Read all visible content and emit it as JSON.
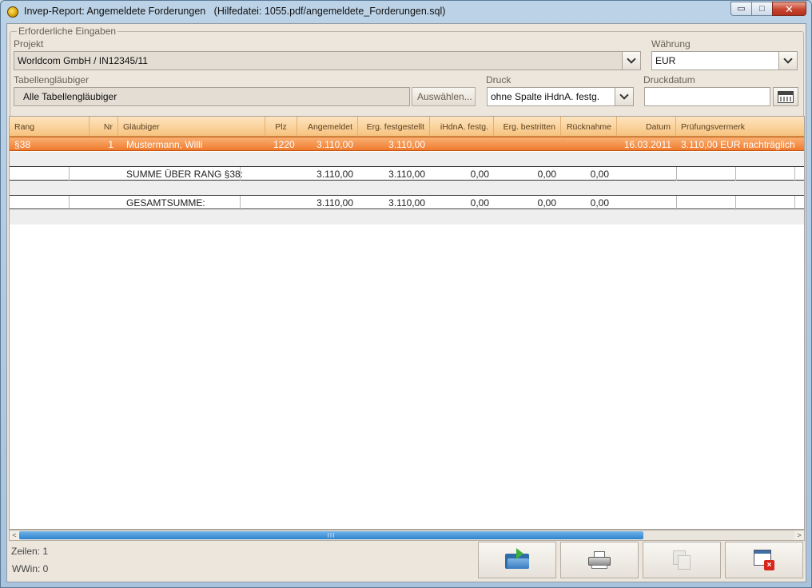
{
  "window": {
    "title": "Invep-Report: Angemeldete Forderungen",
    "helpfile": "(Hilfedatei: 1055.pdf/angemeldete_Forderungen.sql)",
    "minimize_glyph": "▭",
    "maximize_glyph": "□",
    "close_glyph": "✕"
  },
  "inputs": {
    "group_title": "Erforderliche Eingaben",
    "projekt_label": "Projekt",
    "projekt_value": "Worldcom GmbH / IN12345/11",
    "waehrung_label": "Währung",
    "waehrung_value": "EUR",
    "tabglaeubiger_label": "Tabellengläubiger",
    "tabglaeubiger_value": "Alle Tabellengläubiger",
    "auswaehlen_label": "Auswählen...",
    "druck_label": "Druck",
    "druck_value": "ohne Spalte iHdnA. festg.",
    "druckdatum_label": "Druckdatum",
    "druckdatum_value": ""
  },
  "table": {
    "columns": [
      "Rang",
      "Nr",
      "Gläubiger",
      "Plz",
      "Angemeldet",
      "Erg. festgestellt",
      "iHdnA. festg.",
      "Erg. bestritten",
      "Rücknahme",
      "Datum",
      "Prüfungsvermerk"
    ],
    "row_selected": {
      "rang": "§38",
      "nr": "1",
      "glaeubiger": "Mustermann, Willi",
      "plz": "1220",
      "angemeldet": "3.110,00",
      "festgestellt": "3.110,00",
      "datum": "16.03.2011",
      "vermerk": "3.110,00 EUR nachträglich"
    },
    "row_summe_rang": {
      "label": "SUMME ÜBER RANG §38:",
      "angemeldet": "3.110,00",
      "festgestellt": "3.110,00",
      "ihdna": "0,00",
      "bestritten": "0,00",
      "ruecknahme": "0,00"
    },
    "row_gesamt": {
      "label": "GESAMTSUMME:",
      "angemeldet": "3.110,00",
      "festgestellt": "3.110,00",
      "ihdna": "0,00",
      "bestritten": "0,00",
      "ruecknahme": "0,00"
    }
  },
  "scrollbar": {
    "left_arrow": "<",
    "right_arrow": ">",
    "grip": "III"
  },
  "status": {
    "zeilen": "Zeilen: 1",
    "wwin": "WWin: 0"
  },
  "icons": {
    "export": "folder-export-icon",
    "print": "printer-icon",
    "preview": "print-preview-icon",
    "close": "close-window-icon"
  },
  "colors": {
    "accent_header": "#f7c37f",
    "selection": "#f07b2e",
    "panel": "#ece6dc"
  }
}
